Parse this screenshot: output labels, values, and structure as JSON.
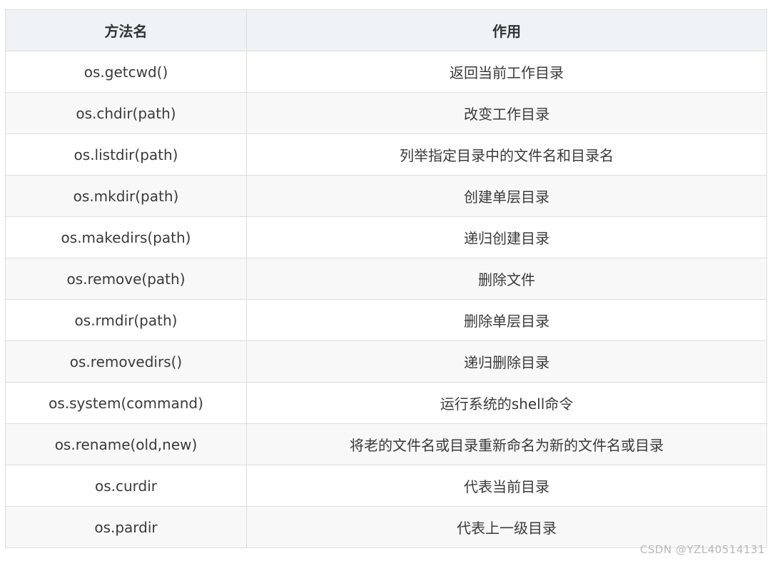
{
  "table": {
    "headers": [
      "方法名",
      "作用"
    ],
    "rows": [
      {
        "method": "os.getcwd()",
        "purpose": "返回当前工作目录"
      },
      {
        "method": "os.chdir(path)",
        "purpose": "改变工作目录"
      },
      {
        "method": "os.listdir(path)",
        "purpose": "列举指定目录中的文件名和目录名"
      },
      {
        "method": "os.mkdir(path)",
        "purpose": "创建单层目录"
      },
      {
        "method": "os.makedirs(path)",
        "purpose": "递归创建目录"
      },
      {
        "method": "os.remove(path)",
        "purpose": "删除文件"
      },
      {
        "method": "os.rmdir(path)",
        "purpose": "删除单层目录"
      },
      {
        "method": "os.removedirs()",
        "purpose": "递归删除目录"
      },
      {
        "method": "os.system(command)",
        "purpose": "运行系统的shell命令"
      },
      {
        "method": "os.rename(old,new)",
        "purpose": "将老的文件名或目录重新命名为新的文件名或目录"
      },
      {
        "method": "os.curdir",
        "purpose": "代表当前目录"
      },
      {
        "method": "os.pardir",
        "purpose": "代表上一级目录"
      }
    ]
  },
  "watermark": "CSDN @YZL40514131"
}
